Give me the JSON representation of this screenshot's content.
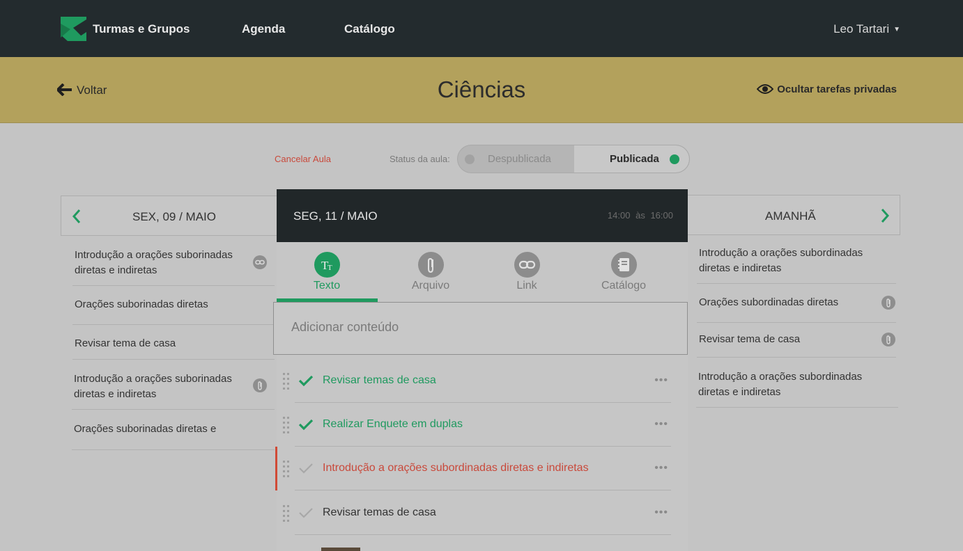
{
  "nav": {
    "links": [
      "Turmas e Grupos",
      "Agenda",
      "Catálogo"
    ],
    "user": "Leo Tartari",
    "accent": "#1f9a5f"
  },
  "subheader": {
    "back": "Voltar",
    "title": "Ciências",
    "hide_private": "Ocultar tarefas privadas"
  },
  "status": {
    "cancel": "Cancelar Aula",
    "label": "Status da aula:",
    "off": "Despublicada",
    "on": "Publicada"
  },
  "left_day": {
    "title": "SEX, 09 / MAIO",
    "items": [
      "Introdução a orações suborinadas diretas e indiretas",
      "Orações suborinadas diretas",
      "Revisar tema de casa",
      "Introdução a orações suborinadas diretas e indiretas",
      "Orações suborinadas diretas e"
    ]
  },
  "right_day": {
    "title": "AMANHÃ",
    "items": [
      "Introdução a orações subordinadas diretas e indiretas",
      "Orações subordinadas diretas",
      "Revisar tema de casa",
      "Introdução a orações subordinadas diretas e indiretas"
    ]
  },
  "modal": {
    "date": "SEG, 11 / MAIO",
    "time_start": "14:00",
    "time_sep": "às",
    "time_end": "16:00",
    "tabs": [
      "Texto",
      "Arquivo",
      "Link",
      "Catálogo"
    ],
    "add_placeholder": "Adicionar conteúdo",
    "tasks": [
      {
        "text": "Revisar temas de casa",
        "state": "done"
      },
      {
        "text": "Realizar Enquete em duplas",
        "state": "done"
      },
      {
        "text": "Introdução a orações subordinadas diretas e indiretas",
        "state": "alert"
      },
      {
        "text": "Revisar temas de casa",
        "state": "normal"
      }
    ],
    "more": "•••"
  }
}
